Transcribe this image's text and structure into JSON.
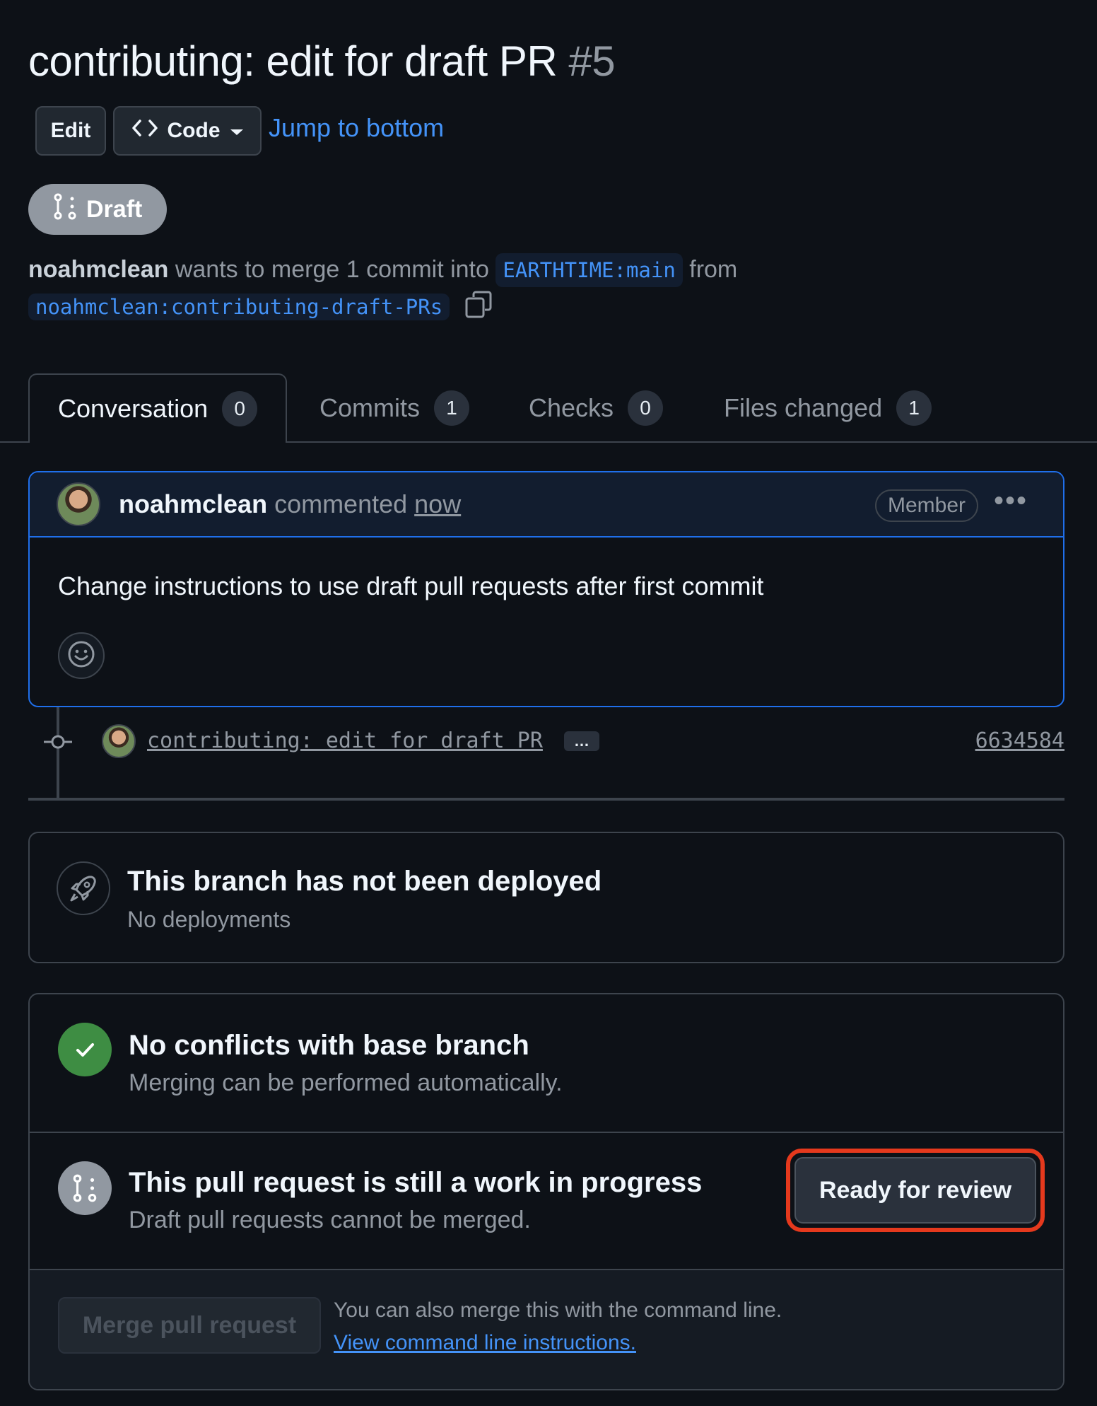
{
  "pr": {
    "title": "contributing: edit for draft PR",
    "number": "#5",
    "status": "Draft",
    "author": "noahmclean",
    "merge_text": "wants to merge 1 commit into",
    "base_branch": "EARTHTIME:main",
    "from_text": "from",
    "head_branch": "noahmclean:contributing-draft-PRs"
  },
  "header_actions": {
    "edit_label": "Edit",
    "code_label": "Code",
    "jump_label": "Jump to bottom"
  },
  "tabs": [
    {
      "label": "Conversation",
      "count": "0"
    },
    {
      "label": "Commits",
      "count": "1"
    },
    {
      "label": "Checks",
      "count": "0"
    },
    {
      "label": "Files changed",
      "count": "1"
    }
  ],
  "comment": {
    "author": "noahmclean",
    "verb": "commented",
    "time": "now",
    "badge": "Member",
    "body": "Change instructions to use draft pull requests after first commit"
  },
  "commit": {
    "message": "contributing: edit for draft PR",
    "ellipsis": "…",
    "sha": "6634584"
  },
  "deployment": {
    "title": "This branch has not been deployed",
    "subtitle": "No deployments"
  },
  "merge": {
    "conflicts_title": "No conflicts with base branch",
    "conflicts_subtitle": "Merging can be performed automatically.",
    "wip_title": "This pull request is still a work in progress",
    "wip_subtitle": "Draft pull requests cannot be merged.",
    "ready_label": "Ready for review",
    "merge_label": "Merge pull request",
    "cli_text": "You can also merge this with the command line.",
    "cli_link": "View command line instructions."
  },
  "colors": {
    "background": "#0d1117",
    "accent_blue": "#4493f8",
    "success_green": "#3e8d43",
    "highlight_red": "#e5391d",
    "draft_gray": "#9198a1"
  }
}
